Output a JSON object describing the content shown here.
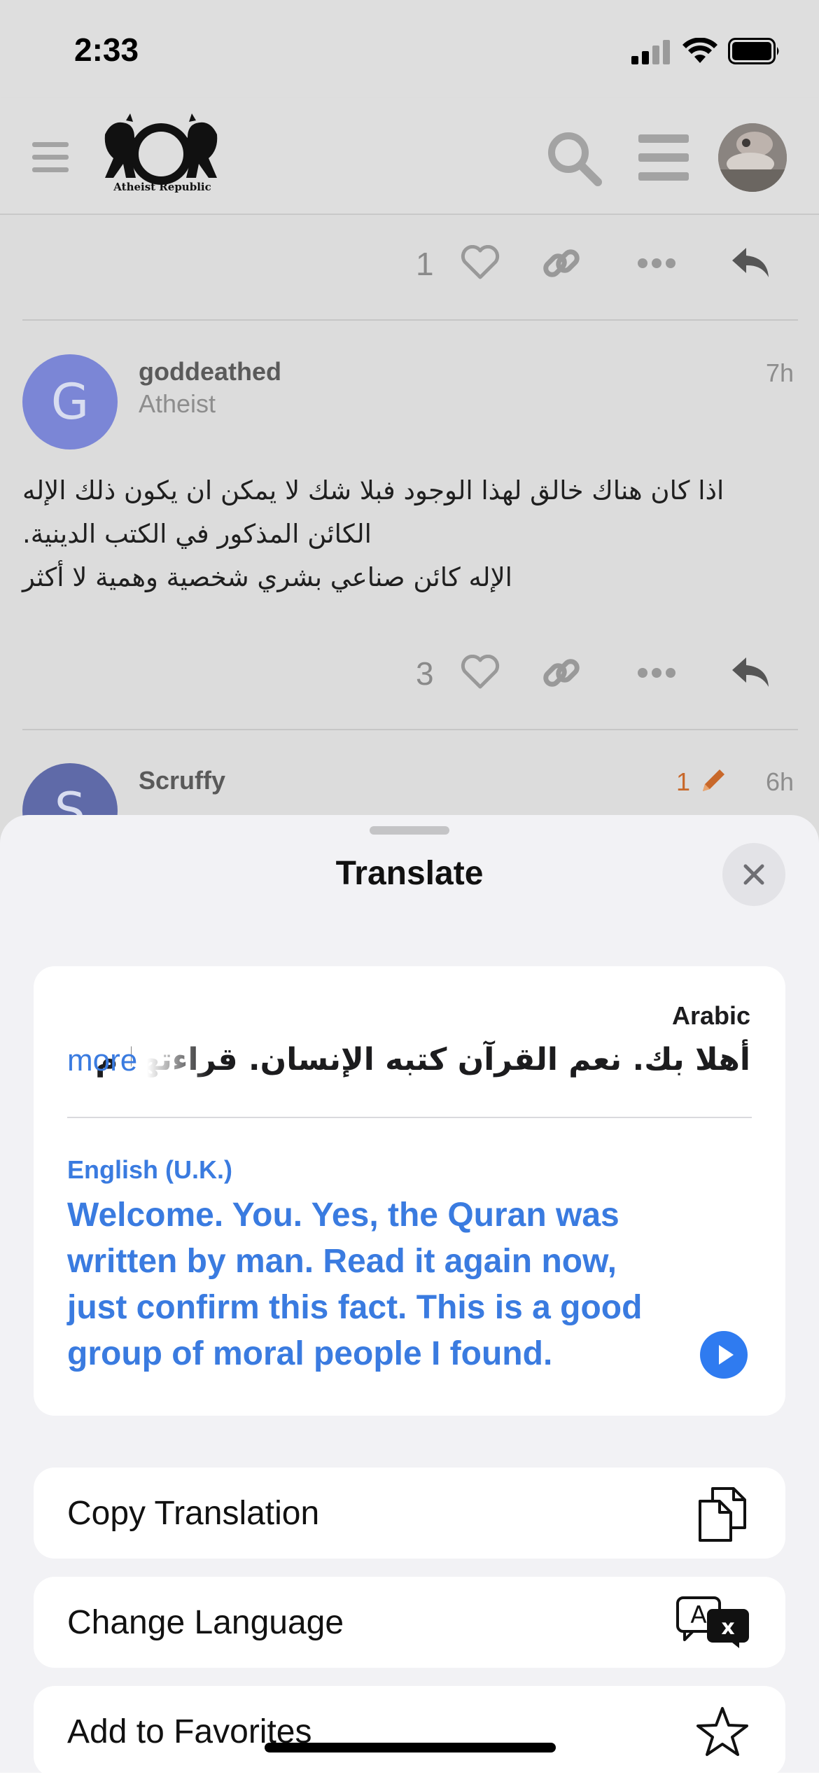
{
  "status_bar": {
    "time": "2:33"
  },
  "top_nav": {
    "logo_text": "Atheist Republic",
    "icons": [
      "hamburger-menu-icon",
      "search-icon",
      "list-menu-icon",
      "user-avatar"
    ]
  },
  "posts": [
    {
      "like_count": "1"
    },
    {
      "avatar_letter": "G",
      "avatar_color": "#7b86d6",
      "username": "goddeathed",
      "user_title": "Atheist",
      "time": "7h",
      "body_lines": [
        "اذا كان هناك خالق لهذا الوجود فبلا شك لا يمكن ان يكون ذلك الإله",
        "الكائن المذكور في الكتب الدينية.",
        "الإله كائن صناعي بشري شخصية وهمية لا أكثر"
      ],
      "like_count": "3"
    },
    {
      "avatar_letter": "S",
      "avatar_color": "#5f6aa8",
      "username": "Scruffy",
      "edit_count": "1",
      "time": "6h"
    }
  ],
  "translate_sheet": {
    "title": "Translate",
    "source_language": "Arabic",
    "source_text": "أهلا بك. نعم القرآن كتبه الإنسان. قراءتها م",
    "more_label": "more",
    "target_language": "English (U.K.)",
    "translation_lines": [
      "Welcome. You. Yes, the Quran was",
      "written by man. Read it again now,",
      "just confirm this fact. This is a good",
      "group of moral people I found."
    ],
    "actions": [
      {
        "label": "Copy Translation",
        "icon": "copy-icon"
      },
      {
        "label": "Change Language",
        "icon": "translate-icon"
      },
      {
        "label": "Add to Favorites",
        "icon": "star-icon"
      }
    ]
  },
  "colors": {
    "accent_blue": "#3a7be0",
    "edit_orange": "#c8682a"
  }
}
